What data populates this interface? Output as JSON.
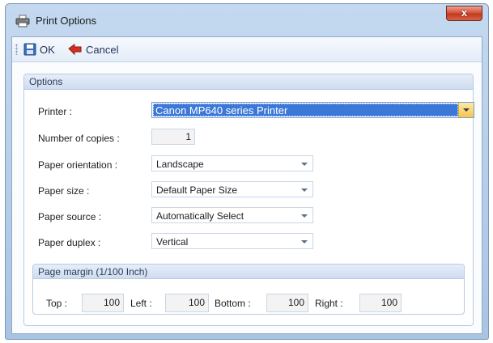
{
  "window": {
    "title": "Print Options",
    "close_label": "x"
  },
  "toolbar": {
    "ok_label": "OK",
    "cancel_label": "Cancel"
  },
  "options": {
    "group_title": "Options",
    "printer": {
      "label": "Printer :",
      "value": "Canon MP640 series Printer"
    },
    "copies": {
      "label": "Number of copies :",
      "value": "1"
    },
    "orientation": {
      "label": "Paper orientation :",
      "value": "Landscape"
    },
    "size": {
      "label": "Paper size :",
      "value": "Default Paper Size"
    },
    "source": {
      "label": "Paper source :",
      "value": "Automatically Select"
    },
    "duplex": {
      "label": "Paper duplex :",
      "value": "Vertical"
    }
  },
  "margins": {
    "group_title": "Page margin (1/100 Inch)",
    "top": {
      "label": "Top :",
      "value": "100"
    },
    "left": {
      "label": "Left :",
      "value": "100"
    },
    "bottom": {
      "label": "Bottom :",
      "value": "100"
    },
    "right": {
      "label": "Right :",
      "value": "100"
    }
  },
  "colors": {
    "selection": "#3b78d8",
    "accent": "#f6c54b",
    "close": "#c13a1f"
  }
}
